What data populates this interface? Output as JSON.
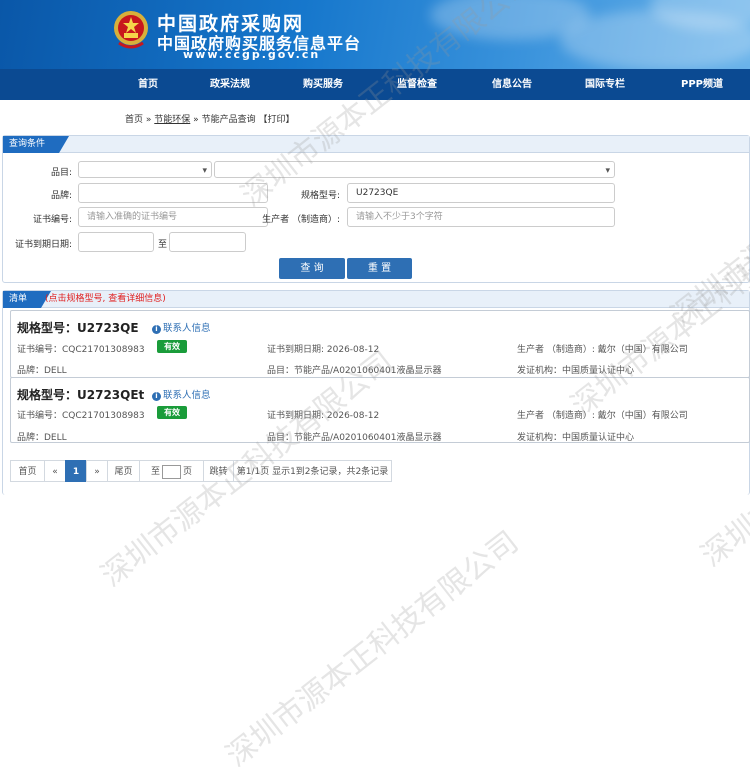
{
  "header": {
    "title_main": "中国政府采购网",
    "title_sub": "中国政府购买服务信息平台",
    "url": "www.ccgp.gov.cn"
  },
  "nav": [
    "首页",
    "政采法规",
    "购买服务",
    "监督检查",
    "信息公告",
    "国际专栏",
    "PPP频道"
  ],
  "breadcrumb": {
    "home": "首页",
    "sep1": "»",
    "section": "节能环保",
    "sep2": "»",
    "page": "节能产品查询",
    "print": "【打印】"
  },
  "query": {
    "panel_title": "查询条件",
    "category_label": "品目:",
    "brand_label": "品牌:",
    "model_label": "规格型号:",
    "model_value": "U2723QE",
    "cert_label": "证书编号:",
    "cert_placeholder": "请输入准确的证书编号",
    "maker_label": "生产者 （制造商）:",
    "maker_placeholder": "请输入不少于3个字符",
    "expire_label": "证书到期日期:",
    "to_label": "至",
    "search_button": "查 询",
    "reset_button": "重 置"
  },
  "results": {
    "panel_title": "清单",
    "note": "(点击规格型号, 查看详细信息)",
    "items": [
      {
        "title": "规格型号：U2723QE",
        "contact": "联系人信息",
        "cert": "证书编号：CQC21701308983",
        "status": "有效",
        "expire": "证书到期日期: 2026-08-12",
        "maker": "生产者 （制造商）: 戴尔（中国）有限公司",
        "brand": "品牌：DELL",
        "category": "品目：节能产品/A0201060401液晶显示器",
        "issuer": "发证机构：中国质量认证中心"
      },
      {
        "title": "规格型号：U2723QEt",
        "contact": "联系人信息",
        "cert": "证书编号：CQC21701308983",
        "status": "有效",
        "expire": "证书到期日期: 2026-08-12",
        "maker": "生产者 （制造商）: 戴尔（中国）有限公司",
        "brand": "品牌：DELL",
        "category": "品目：节能产品/A0201060401液晶显示器",
        "issuer": "发证机构：中国质量认证中心"
      }
    ]
  },
  "pagination": {
    "first": "首页",
    "prev": "«",
    "current": "1",
    "next": "»",
    "last": "尾页",
    "goto_prefix": "至",
    "goto_suffix": "页",
    "jump": "跳转",
    "summary": "第1/1页  显示1到2条记录，共2条记录"
  },
  "watermark": "深圳市源本正科技有限公司",
  "colors": {
    "nav_bg": "#0b4a92",
    "accent": "#2e6fb4",
    "valid_badge": "#1a9c3a",
    "note_red": "#e02020"
  }
}
